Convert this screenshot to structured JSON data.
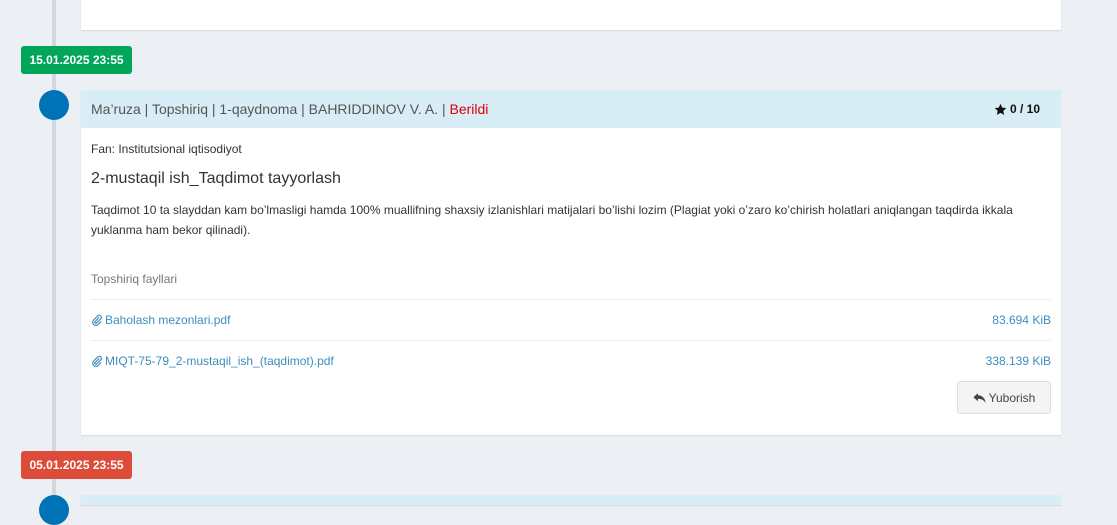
{
  "timeline": {
    "events": [
      {
        "date": "15.01.2025 23:55",
        "date_color": "#00a65a",
        "header": {
          "title": "Ma’ruza | Topshiriq | 1-qaydnoma | BAHRIDDINOV V. A. | ",
          "status": "Berildi",
          "status_color": "#dd0000",
          "score": "0 / 10",
          "score_icon": "star-icon"
        },
        "subject": "Fan: Institutsional iqtisodiyot",
        "task_title": "2-mustaqil ish_Taqdimot tayyorlash",
        "description": "Taqdimot 10 ta slayddan kam bo’lmasligi hamda 100% muallifning shaxsiy izlanishlari matijalari bo’lishi lozim (Plagiat yoki o’zaro ko’chirish holatlari aniqlangan taqdirda ikkala yuklanma ham bekor qilinadi).",
        "files_label": "Topshiriq fayllari",
        "files": [
          {
            "name": "Baholash mezonlari.pdf",
            "size": "83.694 KiB",
            "icon": "paperclip-icon"
          },
          {
            "name": "MIQT-75-79_2-mustaqil_ish_(taqdimot).pdf",
            "size": "338.139 KiB",
            "icon": "paperclip-icon"
          }
        ],
        "send_button": "Yuborish",
        "send_icon": "reply-icon"
      },
      {
        "date": "05.01.2025 23:55",
        "date_color": "#dd4b39"
      }
    ]
  }
}
